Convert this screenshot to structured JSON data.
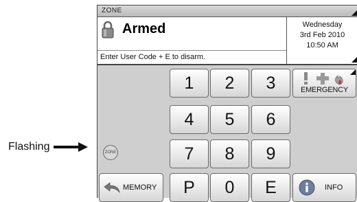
{
  "callout": {
    "label": "Flashing"
  },
  "header": {
    "zone_label": "ZONE"
  },
  "status": {
    "state": "Armed",
    "instruction": "Enter User Code + E to disarm.",
    "day": "Wednesday",
    "date": "3rd Feb 2010",
    "time": "10:50 AM"
  },
  "keypad": {
    "k1": "1",
    "k2": "2",
    "k3": "3",
    "k4": "4",
    "k5": "5",
    "k6": "6",
    "k7": "7",
    "k8": "8",
    "k9": "9",
    "kP": "P",
    "k0": "0",
    "kE": "E"
  },
  "buttons": {
    "emergency": "EMERGENCY",
    "memory": "MEMORY",
    "info": "INFO",
    "zone_indicator": "ZONE"
  },
  "colors": {
    "panel_bg": "#cfcfcf",
    "emergency_red": "#c9302c",
    "info_blue": "#6d7f9c"
  }
}
